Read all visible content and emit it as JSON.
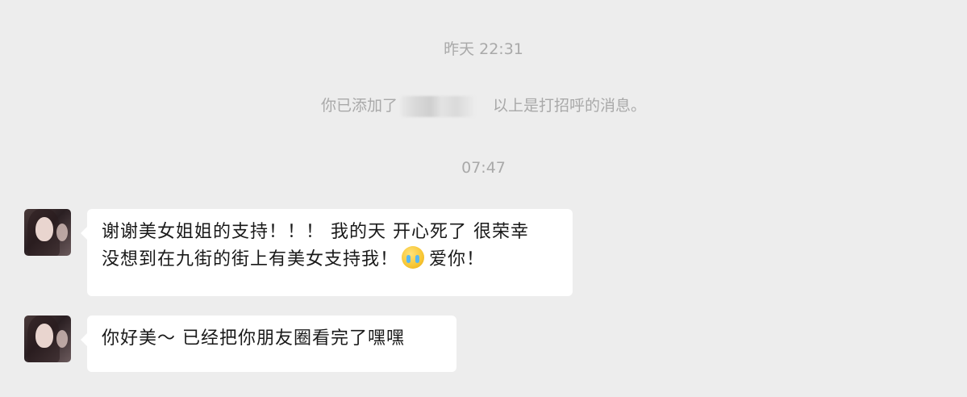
{
  "timestamps": {
    "first": "昨天 22:31",
    "second": "07:47"
  },
  "notice": {
    "prefix": "你已添加了",
    "suffix": "以上是打招呼的消息。"
  },
  "messages": [
    {
      "lines": [
        "谢谢美女姐姐的支持！！！ 我的天 开心死了 很荣幸",
        "没想到在九街的街上有美女支持我！"
      ],
      "emoji": "crying-face-emoji",
      "after_emoji": "爱你！"
    },
    {
      "lines": [
        "你好美～ 已经把你朋友圈看完了嘿嘿"
      ]
    }
  ],
  "colors": {
    "background": "#ededed",
    "bubble": "#ffffff",
    "system_text": "#a9a9a9",
    "message_text": "#191919"
  }
}
